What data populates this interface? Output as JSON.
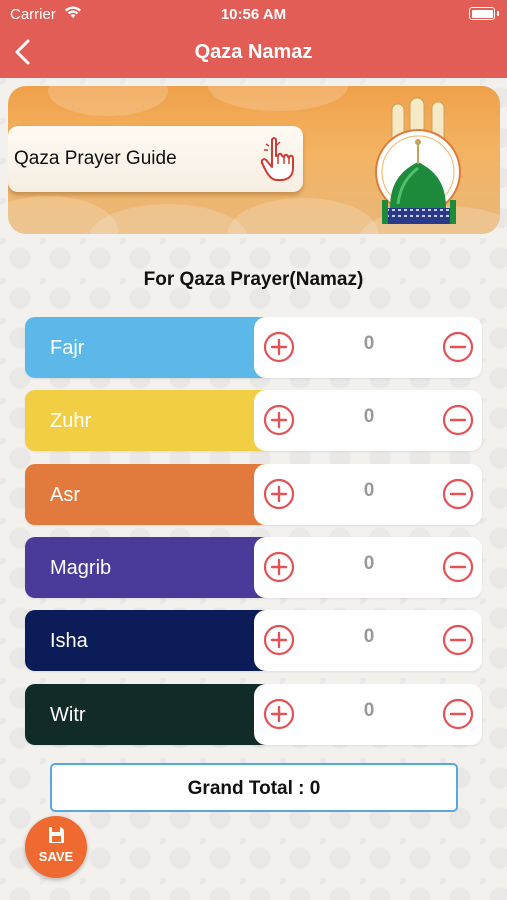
{
  "status_bar": {
    "carrier": "Carrier",
    "time": "10:56 AM"
  },
  "nav": {
    "title": "Qaza Namaz",
    "back_icon": "chevron-left-icon"
  },
  "banner": {
    "guide_label": "Qaza Prayer Guide",
    "hand_icon": "pointing-hand-icon",
    "dome_icon": "green-dome-icon"
  },
  "section_title": "For Qaza Prayer(Namaz)",
  "prayers": [
    {
      "name": "Fajr",
      "count": "0",
      "color": "#5db8ea"
    },
    {
      "name": "Zuhr",
      "count": "0",
      "color": "#f2ce45"
    },
    {
      "name": "Asr",
      "count": "0",
      "color": "#e27a3e"
    },
    {
      "name": "Magrib",
      "count": "0",
      "color": "#4a3a99"
    },
    {
      "name": "Isha",
      "count": "0",
      "color": "#0c1c58"
    },
    {
      "name": "Witr",
      "count": "0",
      "color": "#112b28"
    }
  ],
  "grand_total": "Grand Total : 0",
  "save": {
    "label": "SAVE",
    "icon": "save-icon"
  },
  "colors": {
    "header": "#e35d57",
    "accent_red": "#e25256",
    "save_orange": "#ef6a30",
    "total_border": "#5aa6de"
  }
}
